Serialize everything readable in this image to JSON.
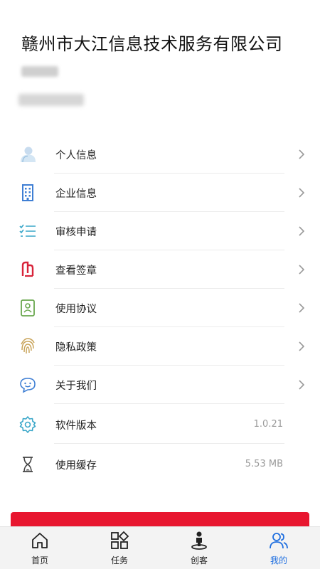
{
  "header": {
    "company_name": "赣州市大江信息技术服务有限公司"
  },
  "menu": {
    "items": [
      {
        "label": "个人信息",
        "icon": "person-icon",
        "chevron": true
      },
      {
        "label": "企业信息",
        "icon": "building-icon",
        "chevron": true
      },
      {
        "label": "审核申请",
        "icon": "checklist-icon",
        "chevron": true
      },
      {
        "label": "查看签章",
        "icon": "seal-icon",
        "chevron": true
      },
      {
        "label": "使用协议",
        "icon": "id-card-icon",
        "chevron": true
      },
      {
        "label": "隐私政策",
        "icon": "fingerprint-icon",
        "chevron": true
      },
      {
        "label": "关于我们",
        "icon": "chat-smile-icon",
        "chevron": true
      },
      {
        "label": "软件版本",
        "icon": "gear-icon",
        "value": "1.0.21"
      },
      {
        "label": "使用缓存",
        "icon": "hourglass-icon",
        "value": "5.53 MB"
      }
    ]
  },
  "tabbar": {
    "tabs": [
      {
        "label": "首页",
        "icon": "home-icon",
        "active": false
      },
      {
        "label": "任务",
        "icon": "grid-icon",
        "active": false
      },
      {
        "label": "创客",
        "icon": "maker-icon",
        "active": false
      },
      {
        "label": "我的",
        "icon": "users-icon",
        "active": true
      }
    ]
  },
  "colors": {
    "accent": "#e8162f",
    "active_tab": "#1f6fe0",
    "icon_blue": "#3f7fd4",
    "icon_teal": "#3aa7c9",
    "icon_red": "#d8243a",
    "icon_green": "#6aa84f",
    "icon_gold": "#c9a45a"
  }
}
